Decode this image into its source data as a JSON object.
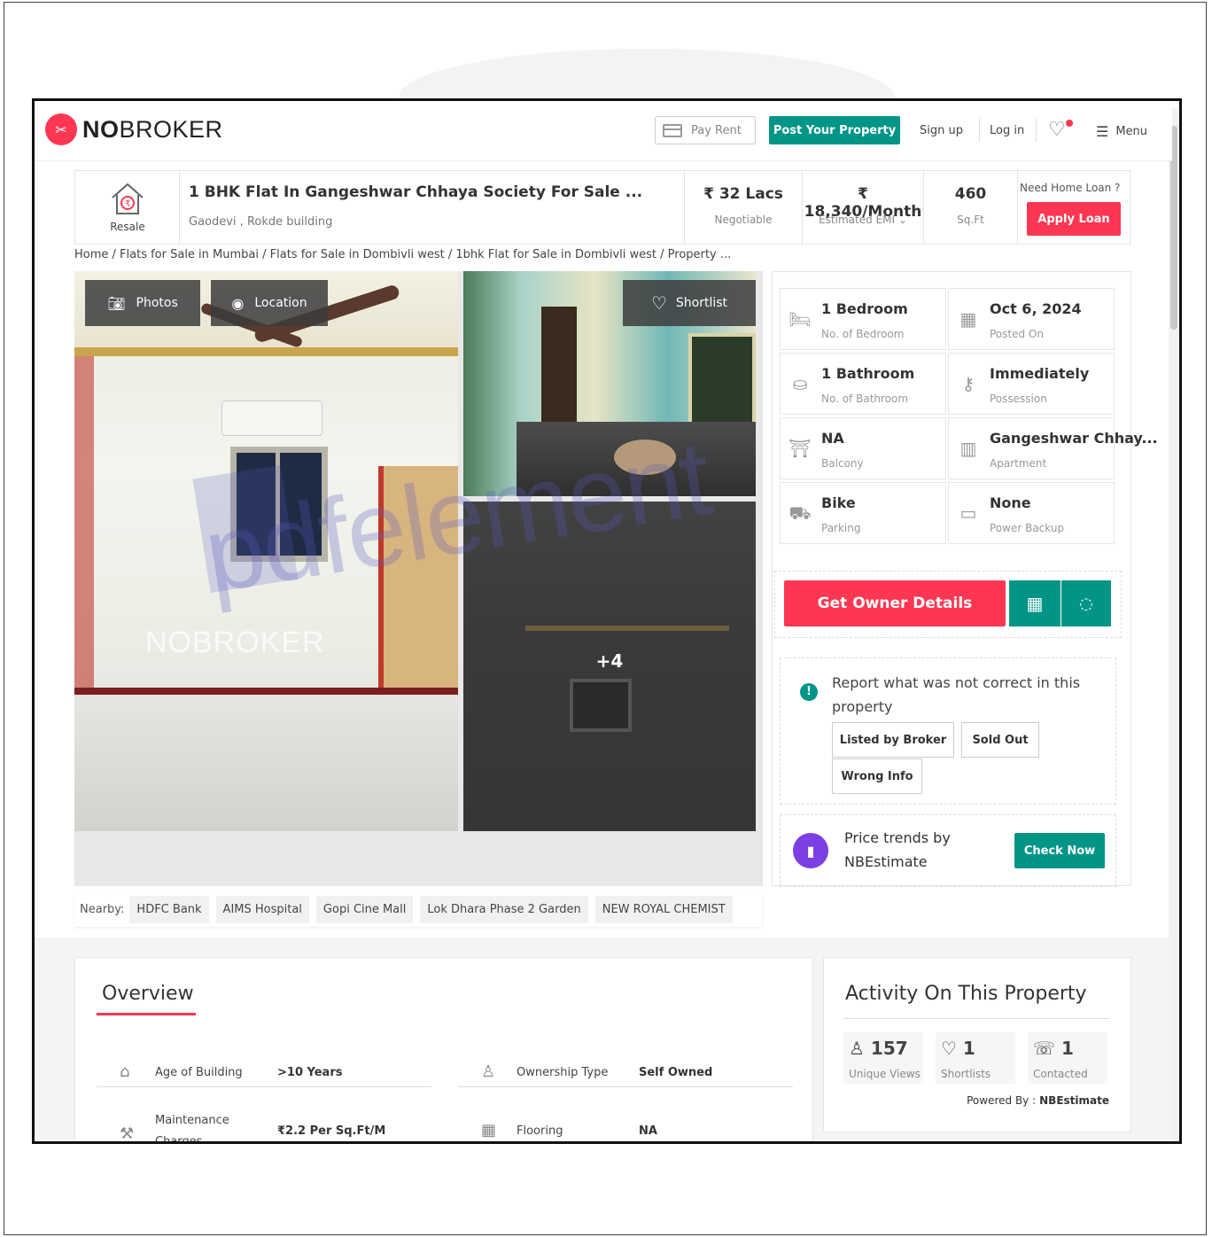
{
  "header": {
    "logo_bold": "NO",
    "logo_rest": "BROKER",
    "pay_rent": "Pay Rent",
    "post_property": "Post Your Property",
    "sign_up": "Sign up",
    "log_in": "Log in",
    "menu": "Menu"
  },
  "listing": {
    "type_label": "Resale",
    "title": "1 BHK Flat In Gangeshwar Chhaya Society For Sale ...",
    "subtitle": "Gaodevi , Rokde building",
    "price": "₹ 32 Lacs",
    "price_note": "Negotiable",
    "emi": "₹ 18,340/Month",
    "emi_note": "Estimated EMI",
    "area": "460",
    "area_unit": "Sq.Ft",
    "loan_question": "Need Home Loan ?",
    "apply_loan": "Apply Loan"
  },
  "breadcrumb": "Home / Flats for Sale in Mumbai / Flats for Sale in Dombivli west / 1bhk Flat for Sale in Dombivli west / Property ...",
  "gallery": {
    "photos": "Photos",
    "location": "Location",
    "shortlist": "Shortlist",
    "more": "+4",
    "watermark": "NOBROKER"
  },
  "details": [
    {
      "value": "1 Bedroom",
      "label": "No. of Bedroom",
      "icon": "bed-icon"
    },
    {
      "value": "Oct 6, 2024",
      "label": "Posted On",
      "icon": "calendar-icon"
    },
    {
      "value": "1 Bathroom",
      "label": "No. of Bathroom",
      "icon": "bathtub-icon"
    },
    {
      "value": "Immediately",
      "label": "Possession",
      "icon": "key-icon"
    },
    {
      "value": "NA",
      "label": "Balcony",
      "icon": "balcony-icon"
    },
    {
      "value": "Gangeshwar Chhay...",
      "label": "Apartment",
      "icon": "building-icon"
    },
    {
      "value": "Bike",
      "label": "Parking",
      "icon": "car-icon"
    },
    {
      "value": "None",
      "label": "Power Backup",
      "icon": "battery-icon"
    }
  ],
  "actions": {
    "owner_details": "Get Owner Details"
  },
  "report": {
    "text": "Report what was not correct in this property",
    "chips": [
      "Listed by Broker",
      "Sold Out",
      "Wrong Info"
    ]
  },
  "trends": {
    "line1": "Price trends by",
    "line2": "NBEstimate",
    "button": "Check Now"
  },
  "nearby": {
    "label": "Nearby:",
    "places": [
      "HDFC Bank",
      "AIMS Hospital",
      "Gopi Cine Mall",
      "Lok Dhara Phase 2 Garden",
      "NEW ROYAL CHEMIST"
    ]
  },
  "overview": {
    "title": "Overview",
    "rows": [
      {
        "label": "Age of Building",
        "value": ">10 Years",
        "icon": "cake-icon"
      },
      {
        "label": "Ownership Type",
        "value": "Self Owned",
        "icon": "owner-icon"
      },
      {
        "label": "Maintenance Charges",
        "value": "₹2.2 Per Sq.Ft/M",
        "icon": "tools-icon"
      },
      {
        "label": "Flooring",
        "value": "NA",
        "icon": "grid-icon"
      }
    ]
  },
  "activity": {
    "title": "Activity On This Property",
    "stats": [
      {
        "value": "157",
        "label": "Unique Views",
        "icon": "user-icon"
      },
      {
        "value": "1",
        "label": "Shortlists",
        "icon": "heart-icon"
      },
      {
        "value": "1",
        "label": "Contacted",
        "icon": "phone-icon"
      }
    ],
    "powered_label": "Powered By :",
    "powered_by": "NBEstimate"
  },
  "overlay_watermark": "pdfelement",
  "colors": {
    "brand_red": "#fd3752",
    "brand_teal": "#009587",
    "estimate_purple": "#7b3fe4"
  }
}
